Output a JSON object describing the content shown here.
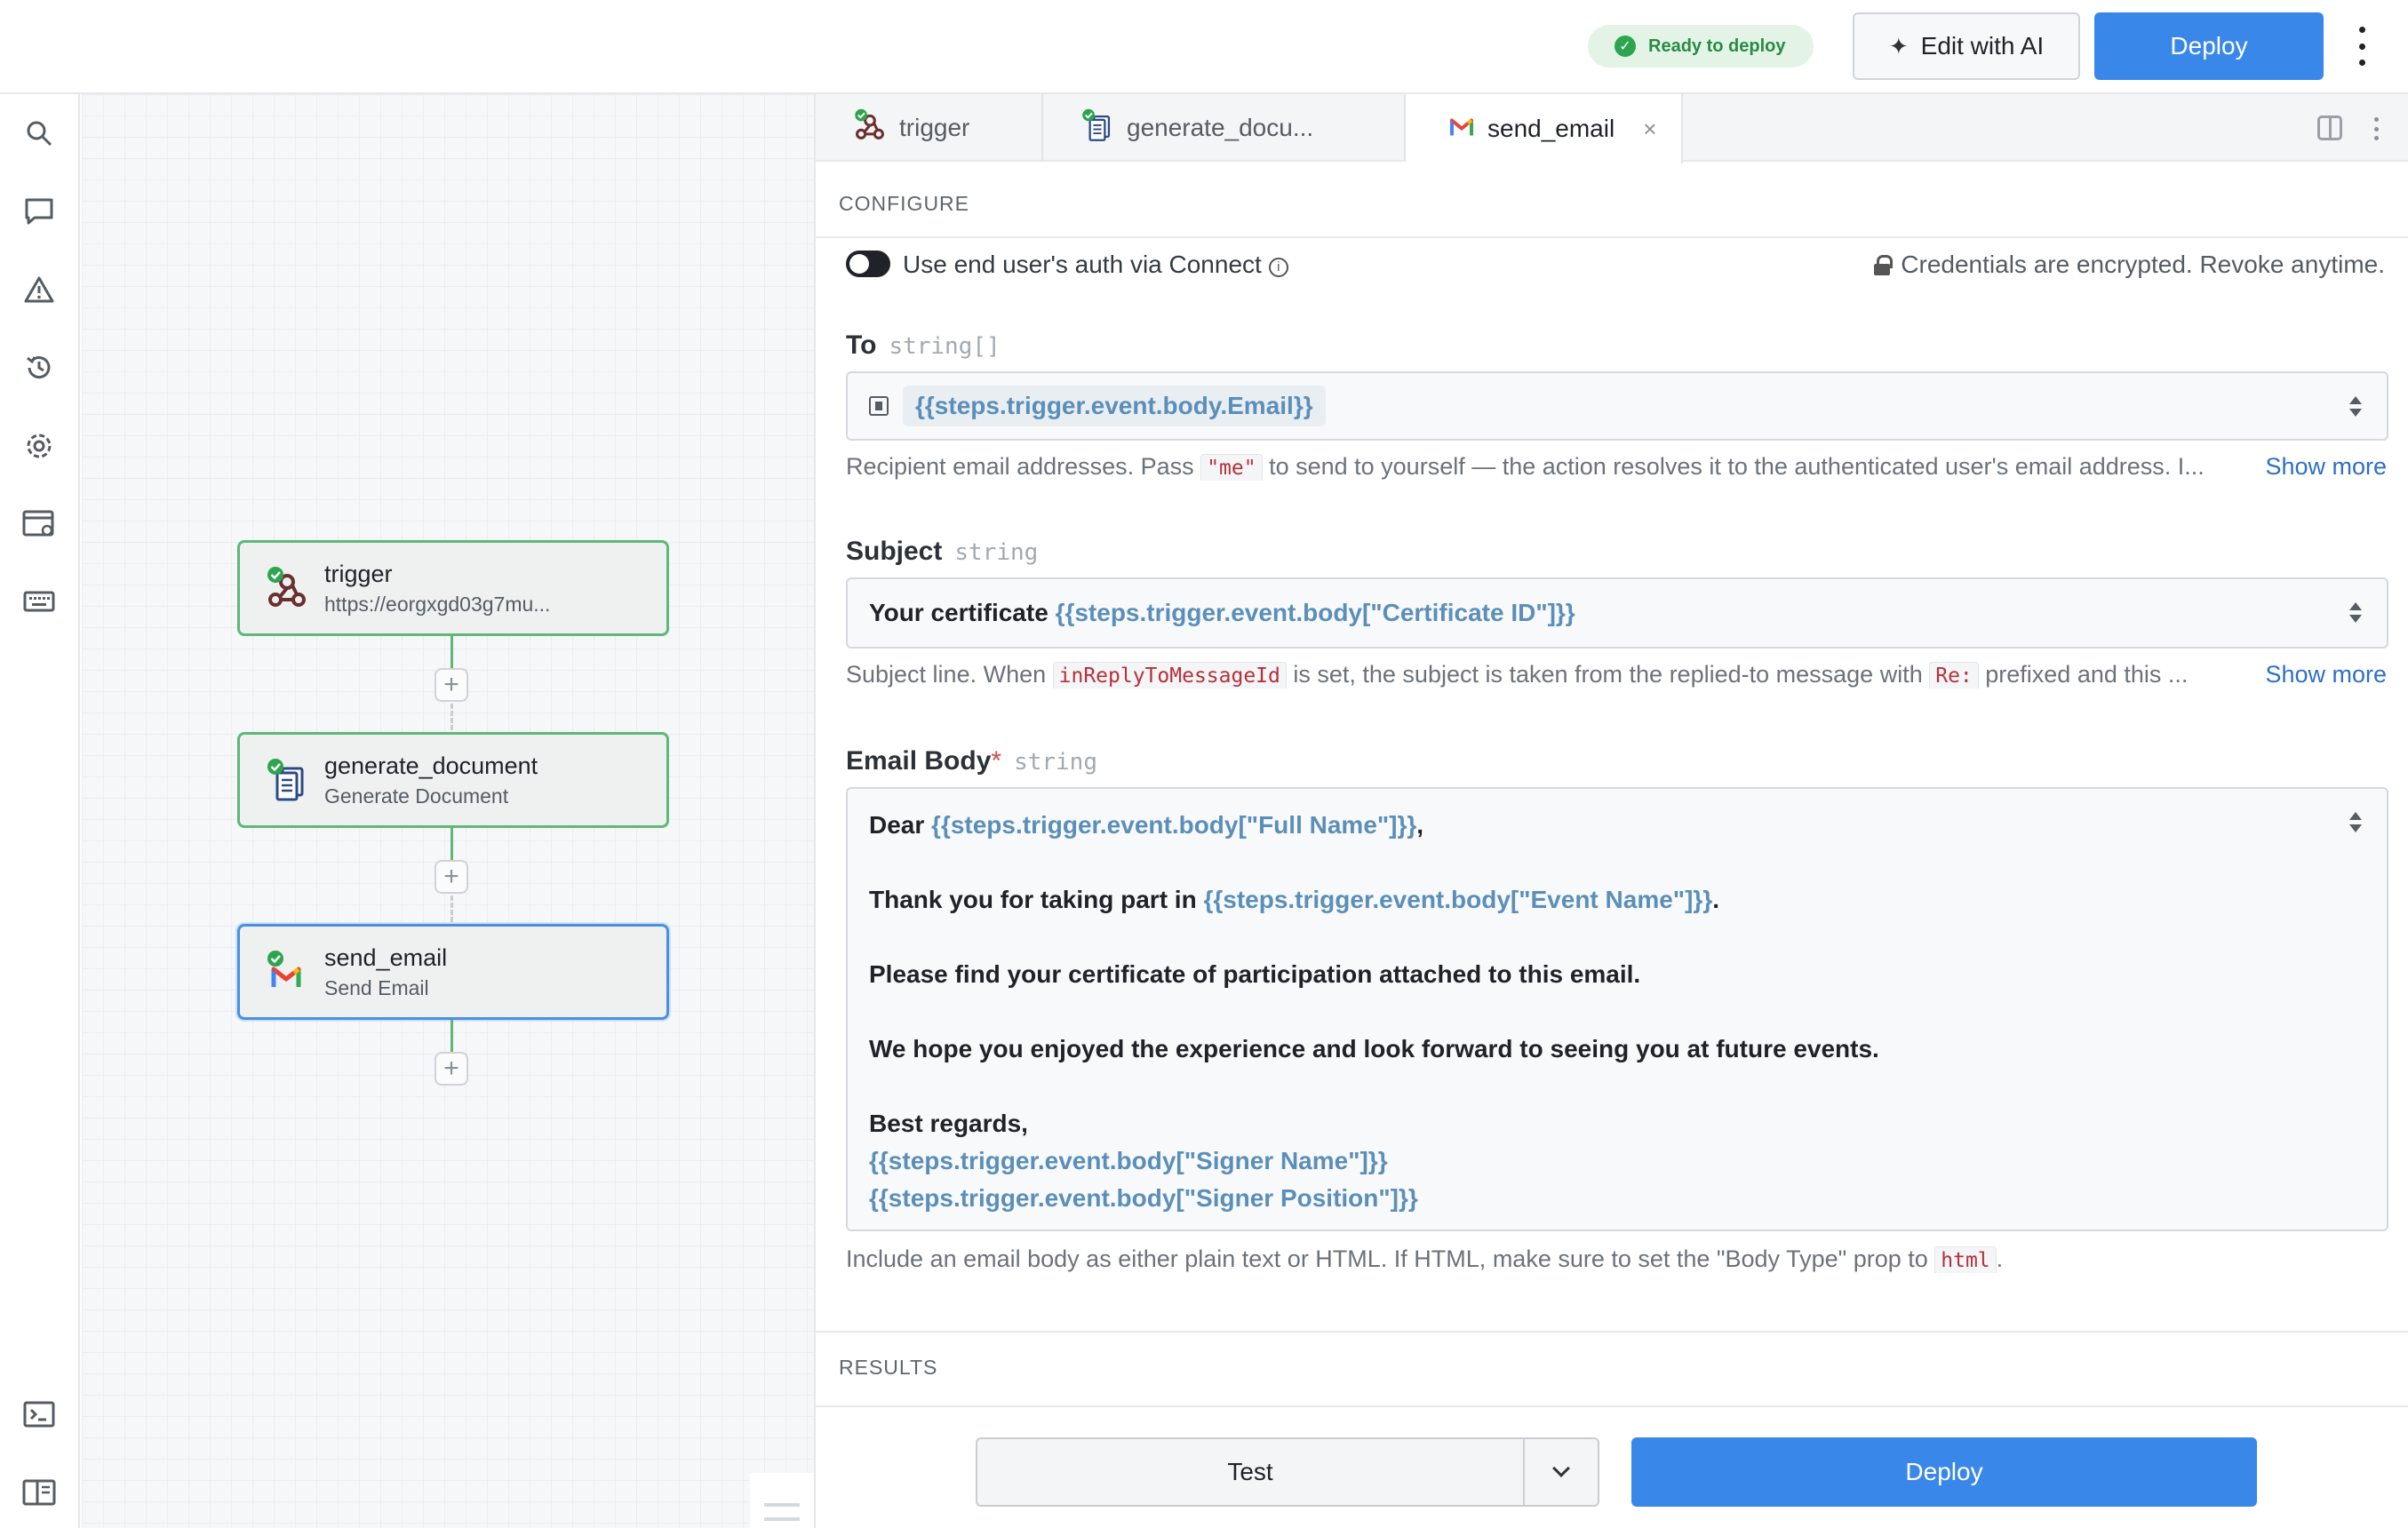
{
  "header": {
    "status": "Ready to deploy",
    "edit_ai_label": "Edit with AI",
    "deploy_label": "Deploy"
  },
  "rail": {
    "icons": [
      "search-icon",
      "comment-icon",
      "warning-icon",
      "history-icon",
      "settings-icon",
      "app-settings-icon",
      "keyboard-icon",
      "terminal-icon",
      "panel-toggle-icon"
    ]
  },
  "workflow": {
    "nodes": [
      {
        "title": "trigger",
        "subtitle": "https://eorgxgd03g7mu...",
        "icon": "webhook-icon",
        "selected": false
      },
      {
        "title": "generate_document",
        "subtitle": "Generate Document",
        "icon": "document-icon",
        "selected": false
      },
      {
        "title": "send_email",
        "subtitle": "Send Email",
        "icon": "gmail-icon",
        "selected": true
      }
    ],
    "add_step_label": "+",
    "zoom_controls": [
      "+",
      "−"
    ]
  },
  "tabs": [
    {
      "label": "trigger",
      "icon": "webhook-icon",
      "active": false
    },
    {
      "label": "generate_docu...",
      "icon": "document-icon",
      "active": false
    },
    {
      "label": "send_email",
      "icon": "gmail-icon",
      "active": true,
      "close": "×"
    }
  ],
  "configure": {
    "section_title": "CONFIGURE",
    "connect_toggle_label": "Use end user's auth via Connect",
    "connect_toggle_on": false,
    "credentials_note": "Credentials are encrypted. Revoke anytime.",
    "show_more": "Show more",
    "to": {
      "label": "To",
      "type": "string[]",
      "value": "{{steps.trigger.event.body.Email}}",
      "help_pre": "Recipient email addresses. Pass ",
      "help_code": "\"me\"",
      "help_post": " to send to yourself — the action resolves it to the authenticated user's email address. I..."
    },
    "subject": {
      "label": "Subject",
      "type": "string",
      "value_text": "Your certificate ",
      "value_expr": "{{steps.trigger.event.body[\"Certificate ID\"]}}",
      "help_pre": "Subject line. When ",
      "help_code1": "inReplyToMessageId",
      "help_mid": " is set, the subject is taken from the replied-to message with ",
      "help_code2": "Re:",
      "help_post": " prefixed and this ..."
    },
    "body": {
      "label": "Email Body",
      "required_mark": "*",
      "type": "string",
      "line1_text": "Dear ",
      "line1_expr": "{{steps.trigger.event.body[\"Full Name\"]}}",
      "line1_end": ",",
      "line2_text": "Thank you for taking part in ",
      "line2_expr": "{{steps.trigger.event.body[\"Event Name\"]}}",
      "line2_end": ".",
      "line3": "Please find your certificate of participation attached to this email.",
      "line4": "We hope you enjoyed the experience and look forward to seeing you at future events.",
      "line5": "Best regards,",
      "line6_expr": "{{steps.trigger.event.body[\"Signer Name\"]}}",
      "line7_expr": "{{steps.trigger.event.body[\"Signer Position\"]}}",
      "help_pre": "Include an email body as either plain text or HTML. If HTML, make sure to set the \"Body Type\" prop to ",
      "help_code": "html",
      "help_post": "."
    }
  },
  "results": {
    "section_title": "RESULTS"
  },
  "actions": {
    "test_label": "Test",
    "deploy_label": "Deploy"
  },
  "colors": {
    "primary": "#3a87ea",
    "success": "#2ea44f",
    "node_border": "#5fb87a",
    "expression": "#5b8fb9"
  }
}
